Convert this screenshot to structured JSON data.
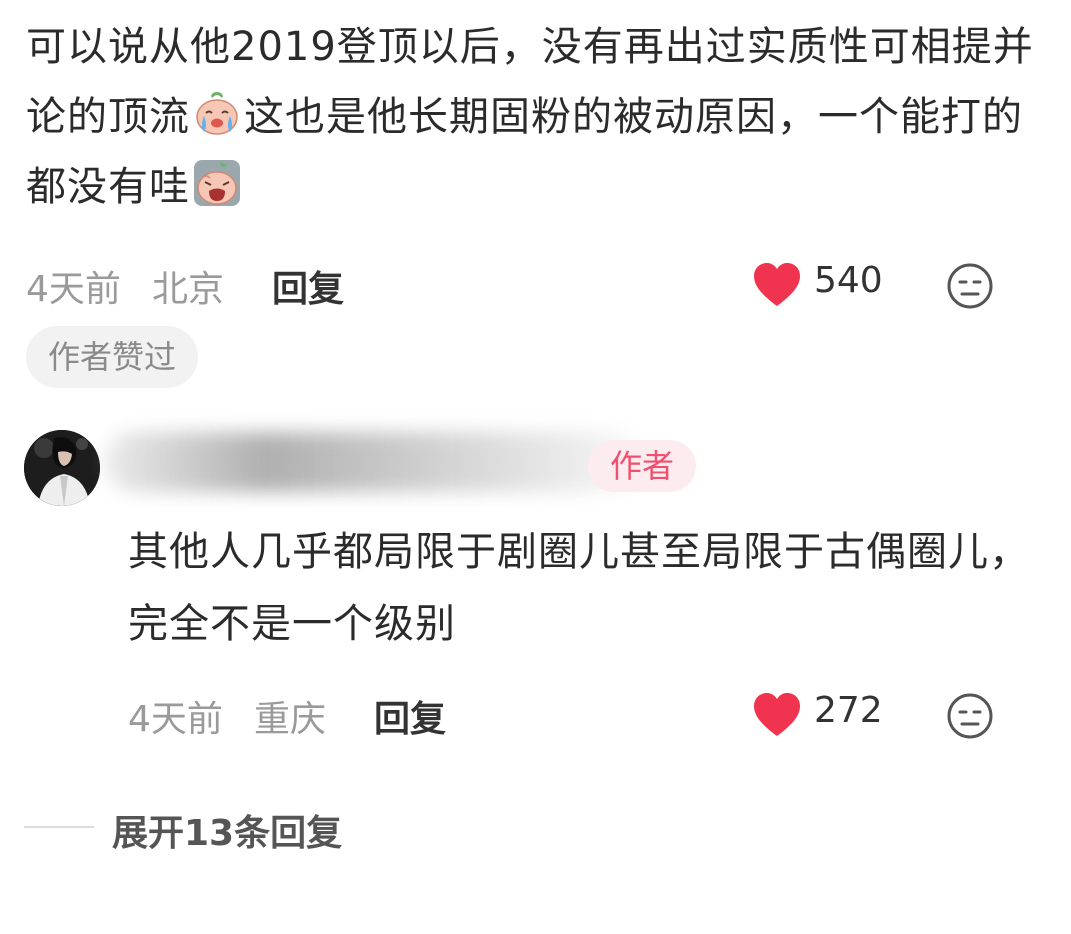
{
  "comment": {
    "text_part1": "可以说从他2019登顶以后，没有再出过实质性可相提并论的顶流",
    "text_part2": "这也是他长期固粉的被动原因，一个能打的都没有哇",
    "emoji_1": "crying-face-emoji",
    "emoji_2": "wailing-face-emoji",
    "time": "4天前",
    "location": "北京",
    "reply_label": "回复",
    "likes": "540",
    "author_liked_badge": "作者赞过"
  },
  "reply": {
    "author_badge": "作者",
    "text": "其他人几乎都局限于剧圈儿甚至局限于古偶圈儿，完全不是一个级别",
    "time": "4天前",
    "location": "重庆",
    "reply_label": "回复",
    "likes": "272"
  },
  "expand": {
    "label": "展开13条回复"
  },
  "colors": {
    "heart": "#f0334f",
    "author_badge_text": "#f0506e",
    "author_badge_bg": "#fdecef",
    "meta_text": "#9a9a9a"
  }
}
